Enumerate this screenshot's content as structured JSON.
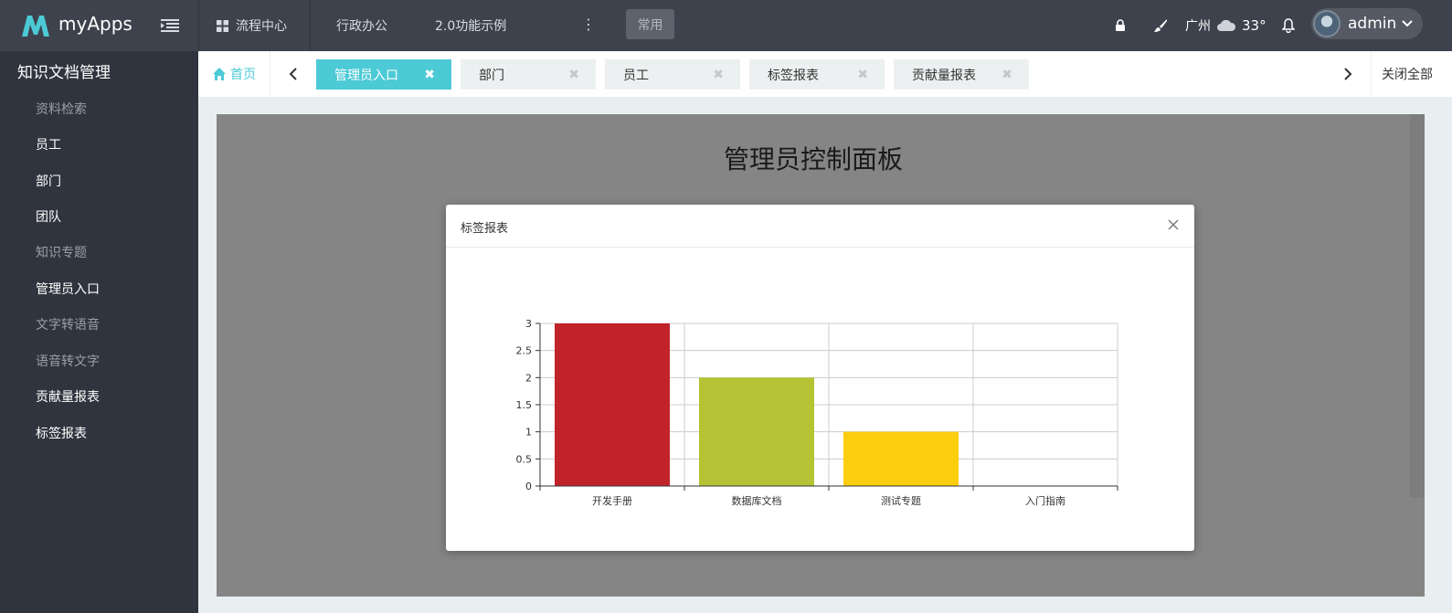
{
  "header": {
    "brand": "myApps",
    "nav": [
      {
        "label": "流程中心",
        "icon": "grid-icon"
      },
      {
        "label": "行政办公"
      },
      {
        "label": "2.0功能示例"
      }
    ],
    "more_icon": "more-vertical-icon",
    "common_label": "常用",
    "city": "广州",
    "temperature": "33°",
    "user": "admin"
  },
  "sidebar": {
    "title": "知识文档管理",
    "items": [
      {
        "label": "资料检索",
        "style": "dim"
      },
      {
        "label": "员工",
        "style": "strong"
      },
      {
        "label": "部门",
        "style": "strong"
      },
      {
        "label": "团队",
        "style": "strong"
      },
      {
        "label": "知识专题",
        "style": "dim"
      },
      {
        "label": "管理员入口",
        "style": "strong"
      },
      {
        "label": "文字转语音",
        "style": "dim"
      },
      {
        "label": "语音转文字",
        "style": "dim"
      },
      {
        "label": "贡献量报表",
        "style": "strong"
      },
      {
        "label": "标签报表",
        "style": "strong"
      }
    ]
  },
  "tabs": {
    "home": "首页",
    "items": [
      {
        "label": "管理员入口",
        "active": true
      },
      {
        "label": "部门",
        "active": false
      },
      {
        "label": "员工",
        "active": false
      },
      {
        "label": "标签报表",
        "active": false
      },
      {
        "label": "贡献量报表",
        "active": false
      }
    ],
    "close_all": "关闭全部"
  },
  "content": {
    "title": "管理员控制面板"
  },
  "modal": {
    "title": "标签报表",
    "close_icon": "close-icon"
  },
  "chart_data": {
    "type": "bar",
    "categories": [
      "开发手册",
      "数据库文档",
      "测试专题",
      "入门指南"
    ],
    "values": [
      3,
      2,
      1,
      0
    ],
    "colors": [
      "#c1232b",
      "#b5c334",
      "#fcce10",
      "#e87c25"
    ],
    "yticks": [
      "0",
      "0.5",
      "1",
      "1.5",
      "2",
      "2.5",
      "3"
    ],
    "ylim": [
      0,
      3
    ],
    "grid": true
  }
}
